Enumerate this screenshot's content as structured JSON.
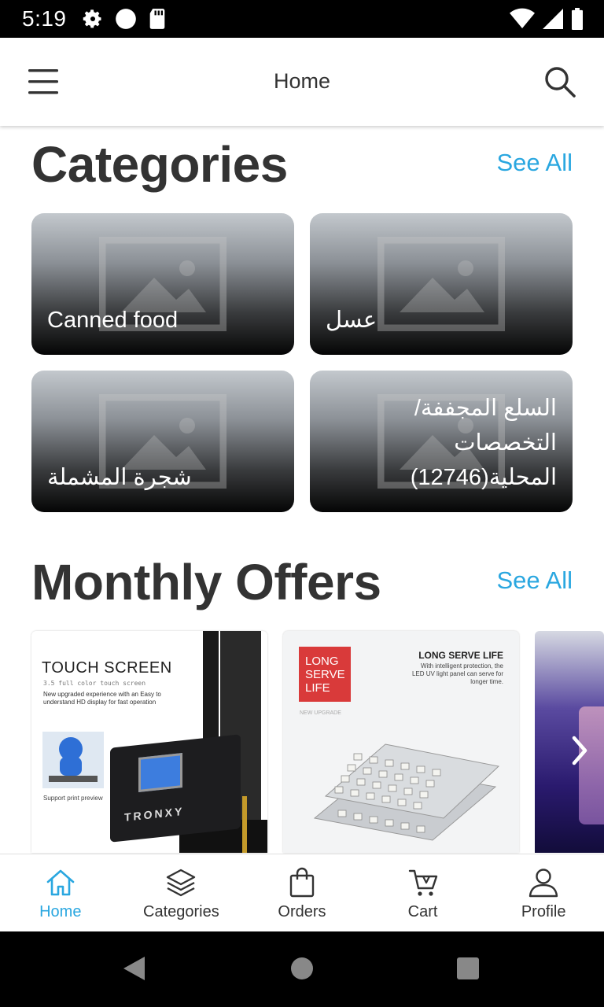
{
  "status_bar": {
    "time": "5:19"
  },
  "app_bar": {
    "title": "Home"
  },
  "categories": {
    "title": "Categories",
    "see_all": "See All",
    "items": [
      {
        "label": "Canned food"
      },
      {
        "label": "عسل"
      },
      {
        "label": "شجرة المشملة"
      },
      {
        "label": "السلع المجففة/ التخصصات المحلية(12746)"
      }
    ]
  },
  "monthly_offers": {
    "title": "Monthly Offers",
    "see_all": "See All",
    "offer1": {
      "heading": "TOUCH SCREEN",
      "subheading": "3.5 full color touch screen",
      "line1": "New upgraded experience with an Easy to",
      "line2": "understand HD display for fast operation",
      "caption": "Support print preview",
      "brand": "TRONXY"
    },
    "offer2": {
      "badge_line1": "LONG",
      "badge_line2": "SERVE",
      "badge_line3": "LIFE",
      "heading": "LONG SERVE LIFE",
      "line1": "With intelligent protection, the",
      "line2": "LED UV light panel can serve for",
      "line3": "longer time.",
      "tag": "NEW UPGRADE"
    }
  },
  "bottom_nav": {
    "items": [
      {
        "label": "Home"
      },
      {
        "label": "Categories"
      },
      {
        "label": "Orders"
      },
      {
        "label": "Cart"
      },
      {
        "label": "Profile"
      }
    ]
  },
  "colors": {
    "accent": "#2aa7e0",
    "text": "#333333"
  }
}
